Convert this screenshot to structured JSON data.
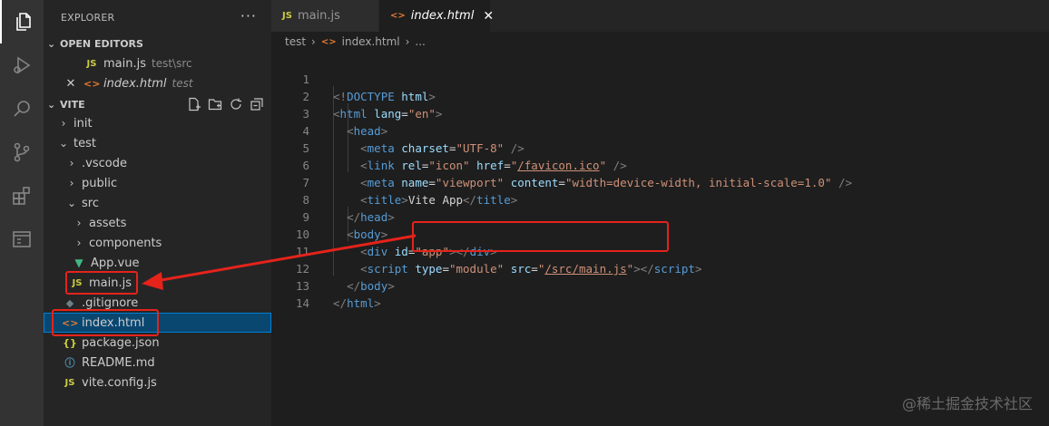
{
  "activity_bar": {
    "icons": [
      "files-icon",
      "run-debug-icon",
      "search-icon",
      "source-control-icon",
      "extensions-icon",
      "remote-explorer-icon"
    ]
  },
  "sidebar": {
    "title": "EXPLORER",
    "more": "···",
    "open_editors": {
      "label": "OPEN EDITORS",
      "items": [
        {
          "icon": "JS",
          "name": "main.js",
          "desc": "test\\src"
        },
        {
          "icon": "<>",
          "name": "index.html",
          "desc": "test",
          "close": "✕"
        }
      ]
    },
    "workspace": {
      "label": "VITE",
      "tree": [
        {
          "chev": "›",
          "name": "init"
        },
        {
          "chev": "⌄",
          "name": "test"
        },
        {
          "chev": "›",
          "name": ".vscode"
        },
        {
          "chev": "›",
          "name": "public"
        },
        {
          "chev": "⌄",
          "name": "src"
        },
        {
          "chev": "›",
          "name": "assets"
        },
        {
          "chev": "›",
          "name": "components"
        },
        {
          "icon": "▼",
          "name": "App.vue"
        },
        {
          "icon": "JS",
          "name": "main.js"
        },
        {
          "icon": "◆",
          "name": ".gitignore"
        },
        {
          "icon": "<>",
          "name": "index.html"
        },
        {
          "icon": "{}",
          "name": "package.json"
        },
        {
          "icon": "ⓘ",
          "name": "README.md"
        },
        {
          "icon": "JS",
          "name": "vite.config.js"
        }
      ]
    }
  },
  "tabs": [
    {
      "icon": "JS",
      "label": "main.js"
    },
    {
      "icon": "<>",
      "label": "index.html",
      "close": "✕"
    }
  ],
  "breadcrumb": {
    "parts": [
      "test",
      "index.html",
      "..."
    ],
    "sep": "›",
    "file_icon": "<>"
  },
  "editor": {
    "line_numbers": [
      "1",
      "2",
      "3",
      "4",
      "5",
      "6",
      "7",
      "8",
      "9",
      "10",
      "11",
      "12",
      "13",
      "14"
    ]
  },
  "watermark": "@稀土掘金技术社区"
}
